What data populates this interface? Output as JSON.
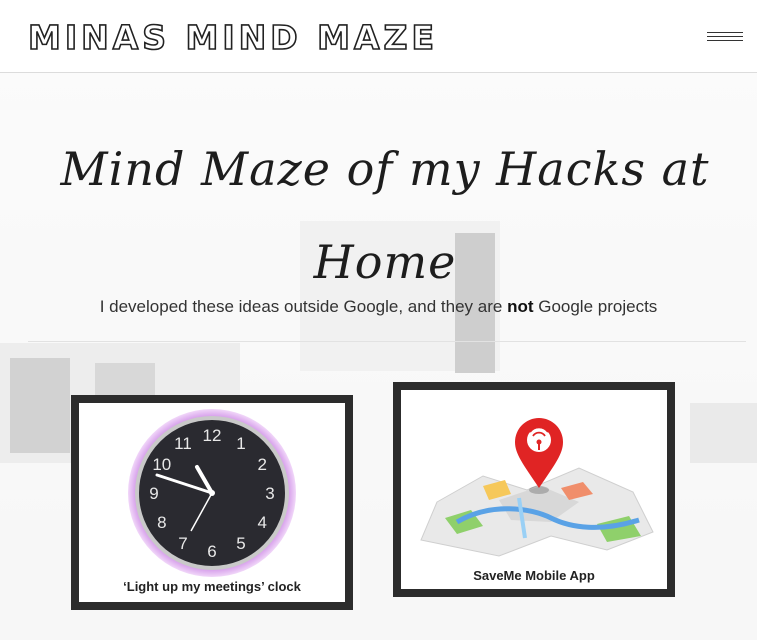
{
  "header": {
    "logo_text": "MINAS MIND MAZE"
  },
  "hero": {
    "title": "Mind Maze of my Hacks at Home",
    "subtitle_part1": "I developed these ideas outside Google, and they are ",
    "subtitle_bold": "not",
    "subtitle_part2": " Google projects"
  },
  "projects": [
    {
      "caption": "‘Light up my meetings’ clock",
      "icon": "clock-icon"
    },
    {
      "caption": "SaveMe Mobile App",
      "icon": "map-pin-icon"
    }
  ],
  "clock_numbers": [
    "12",
    "1",
    "2",
    "3",
    "4",
    "5",
    "6",
    "7",
    "8",
    "9",
    "10",
    "11"
  ]
}
